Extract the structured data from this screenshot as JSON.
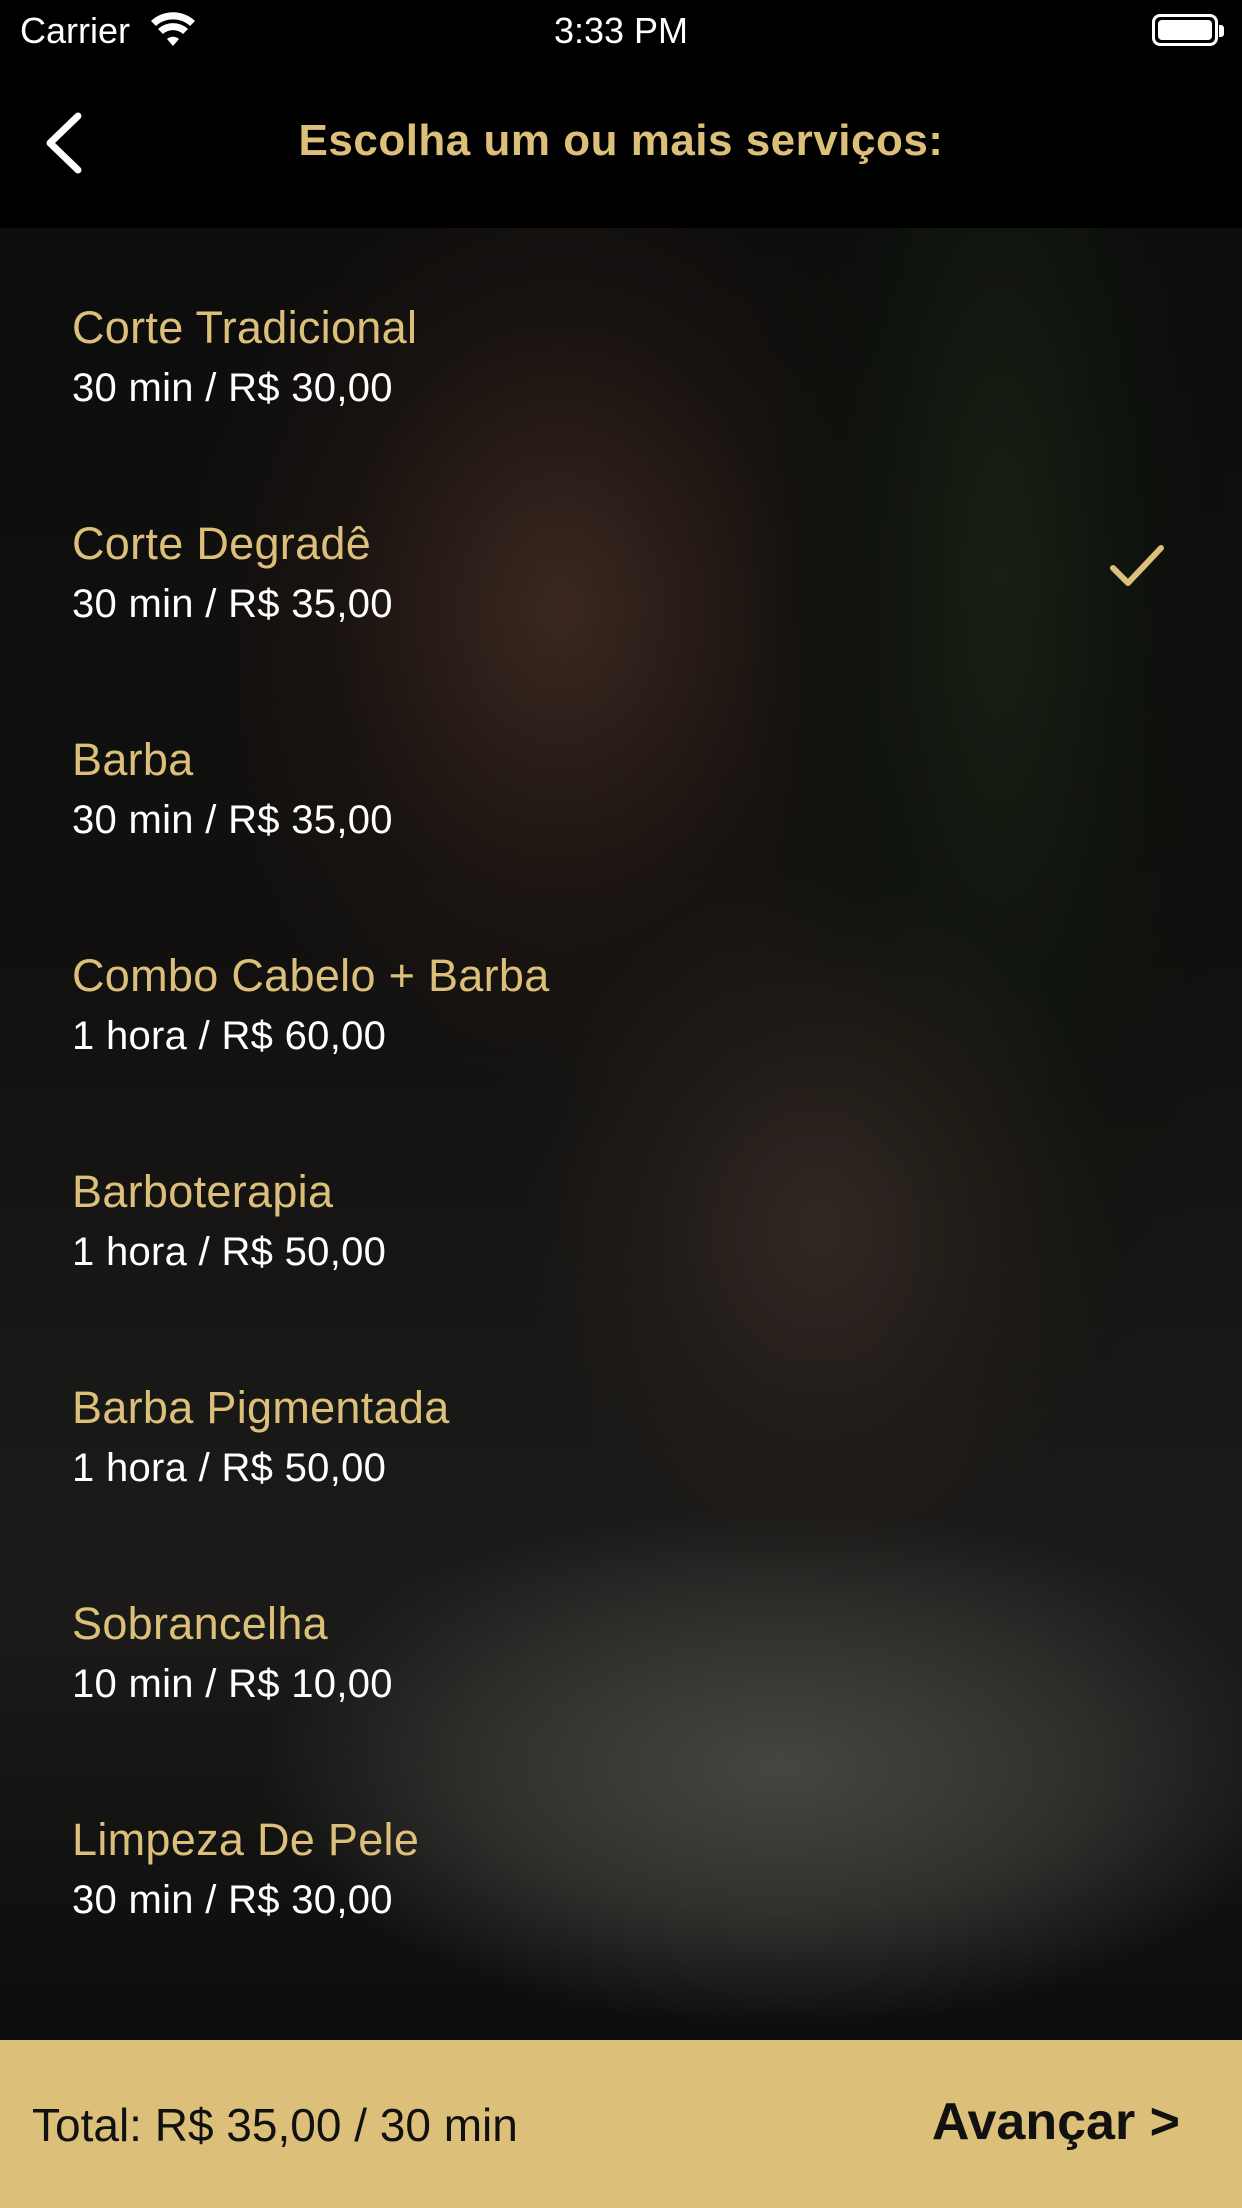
{
  "status_bar": {
    "carrier": "Carrier",
    "time": "3:33 PM",
    "wifi_icon": "wifi-icon",
    "battery_icon": "battery-icon"
  },
  "nav": {
    "back_icon": "chevron-left-icon",
    "title": "Escolha um ou mais serviços:"
  },
  "services": [
    {
      "name": "Corte Tradicional",
      "info": "30 min / R$ 30,00",
      "selected": false
    },
    {
      "name": "Corte Degradê",
      "info": "30 min / R$ 35,00",
      "selected": true
    },
    {
      "name": "Barba",
      "info": "30 min / R$ 35,00",
      "selected": false
    },
    {
      "name": "Combo Cabelo + Barba",
      "info": "1 hora / R$ 60,00",
      "selected": false
    },
    {
      "name": "Barboterapia",
      "info": "1 hora / R$ 50,00",
      "selected": false
    },
    {
      "name": "Barba Pigmentada",
      "info": "1 hora / R$ 50,00",
      "selected": false
    },
    {
      "name": "Sobrancelha",
      "info": "10 min / R$ 10,00",
      "selected": false
    },
    {
      "name": "Limpeza De Pele",
      "info": "30 min / R$ 30,00",
      "selected": false
    }
  ],
  "footer": {
    "total": "Total: R$ 35,00 / 30 min",
    "advance_label": "Avançar >"
  },
  "colors": {
    "accent": "#dcc07a",
    "background": "#000000",
    "text_light": "#ffffff",
    "text_dark": "#111111"
  }
}
